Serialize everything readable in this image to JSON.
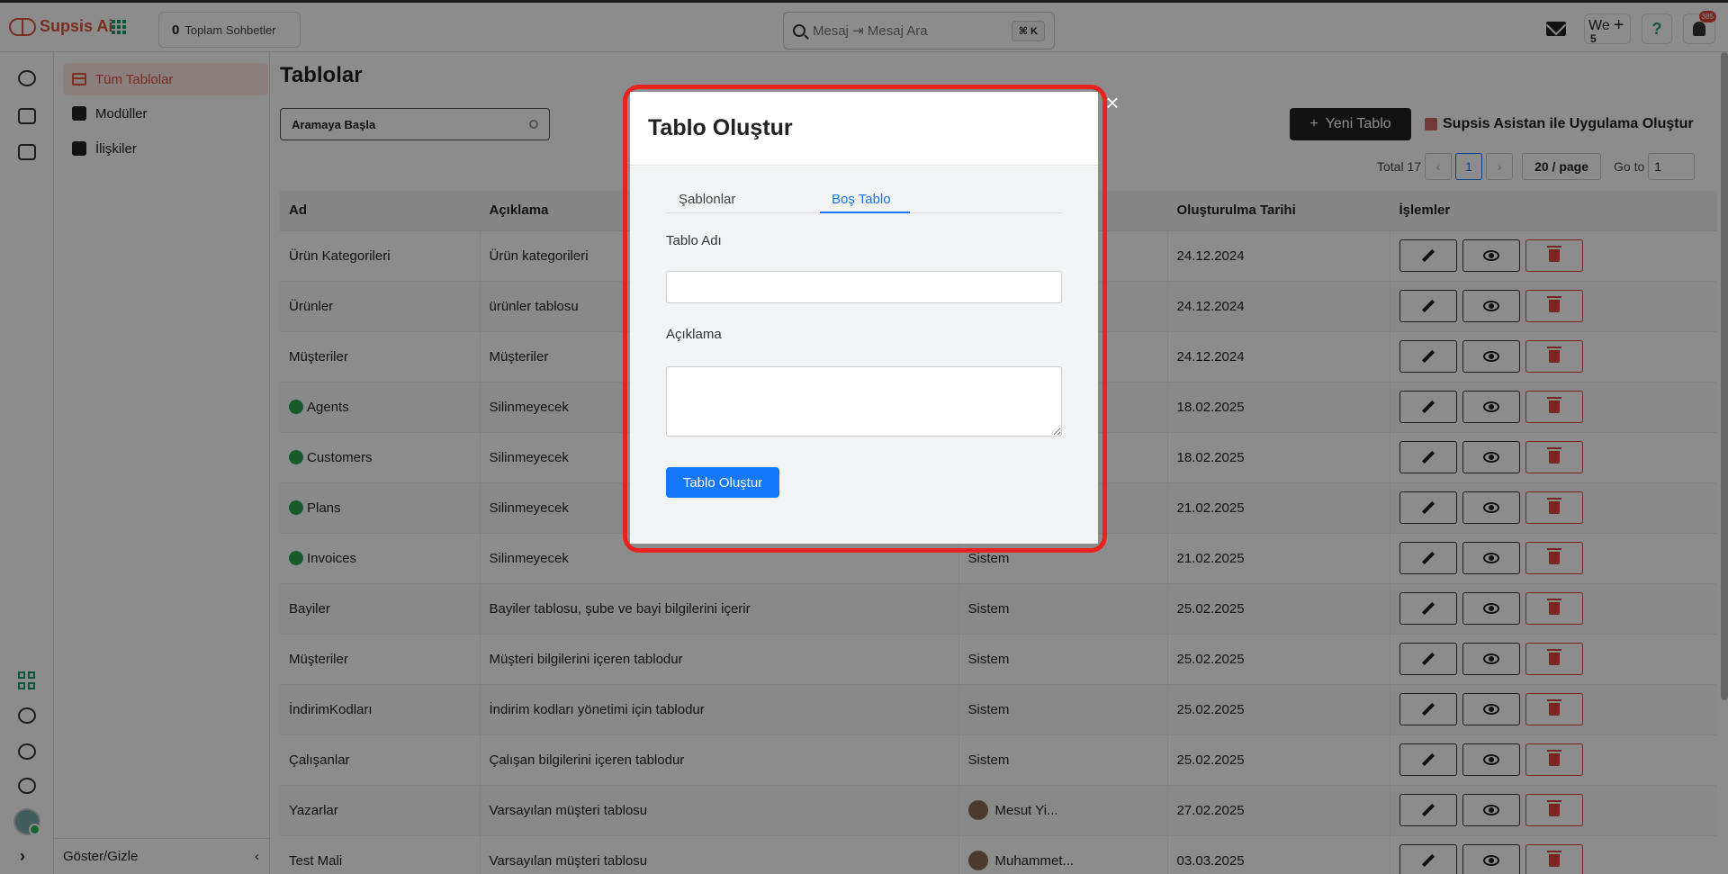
{
  "topbar": {
    "brand": "Supsis Ai",
    "conversation_count": "0",
    "conversation_label": "Toplam Sohbetler",
    "search_placeholder": "Mesaj ⇥ Mesaj Ara",
    "search_shortcut": "⌘ K",
    "user_initials": "We",
    "user_sub": "5",
    "help": "?",
    "notification_count": "385"
  },
  "sidebar": {
    "items": [
      {
        "label": "Tüm Tablolar",
        "icon": "table-icon"
      },
      {
        "label": "Modüller",
        "icon": "puzzle-icon"
      },
      {
        "label": "İlişkiler",
        "icon": "puzzle-icon"
      }
    ],
    "footer": "Göster/Gizle"
  },
  "main": {
    "title": "Tablolar",
    "search_placeholder": "Aramaya Başla",
    "new_table": "Yeni Tablo",
    "assistant": "Supsis Asistan ile Uygulama Oluştur",
    "pagination": {
      "total": "Total 17",
      "page": "1",
      "page_size": "20 / page",
      "goto_label": "Go to",
      "goto_value": "1"
    },
    "columns": [
      "Ad",
      "Açıklama",
      "",
      "Oluşturulma Tarihi",
      "İşlemler"
    ],
    "rows": [
      {
        "name": "Ürün Kategorileri",
        "desc": "Ürün kategorileri",
        "owner": "",
        "date": "24.12.2024",
        "dot": false
      },
      {
        "name": "Ürünler",
        "desc": "ürünler tablosu",
        "owner": "",
        "date": "24.12.2024",
        "dot": false
      },
      {
        "name": "Müşteriler",
        "desc": "Müşteriler",
        "owner": "",
        "date": "24.12.2024",
        "dot": false
      },
      {
        "name": "Agents",
        "desc": "Silinmeyecek",
        "owner": "",
        "date": "18.02.2025",
        "dot": true
      },
      {
        "name": "Customers",
        "desc": "Silinmeyecek",
        "owner": "",
        "date": "18.02.2025",
        "dot": true
      },
      {
        "name": "Plans",
        "desc": "Silinmeyecek",
        "owner": "",
        "date": "21.02.2025",
        "dot": true
      },
      {
        "name": "Invoices",
        "desc": "Silinmeyecek",
        "owner": "Sistem",
        "date": "21.02.2025",
        "dot": true
      },
      {
        "name": "Bayiler",
        "desc": "Bayiler tablosu, şube ve bayi bilgilerini içerir",
        "owner": "Sistem",
        "date": "25.02.2025",
        "dot": false
      },
      {
        "name": "Müşteriler",
        "desc": "Müşteri bilgilerini içeren tablodur",
        "owner": "Sistem",
        "date": "25.02.2025",
        "dot": false
      },
      {
        "name": "İndirimKodları",
        "desc": "İndirim kodları yönetimi için tablodur",
        "owner": "Sistem",
        "date": "25.02.2025",
        "dot": false
      },
      {
        "name": "Çalışanlar",
        "desc": "Çalışan bilgilerini içeren tablodur",
        "owner": "Sistem",
        "date": "25.02.2025",
        "dot": false
      },
      {
        "name": "Yazarlar",
        "desc": "Varsayılan müşteri tablosu",
        "owner": "Mesut Yi...",
        "date": "27.02.2025",
        "dot": false,
        "avatar": true
      },
      {
        "name": "Test Mali",
        "desc": "Varsayılan müşteri tablosu",
        "owner": "Muhammet...",
        "date": "03.03.2025",
        "dot": false,
        "avatar": true
      }
    ]
  },
  "modal": {
    "title": "Tablo Oluştur",
    "tabs": [
      "Şablonlar",
      "Boş Tablo"
    ],
    "active_tab": "Boş Tablo",
    "name_label": "Tablo Adı",
    "name_value": "",
    "desc_label": "Açıklama",
    "desc_value": "",
    "submit": "Tablo Oluştur",
    "close": "×"
  },
  "colors": {
    "accent": "#e0533d",
    "primary": "#1677ff",
    "highlight_ring": "#e8231d"
  }
}
